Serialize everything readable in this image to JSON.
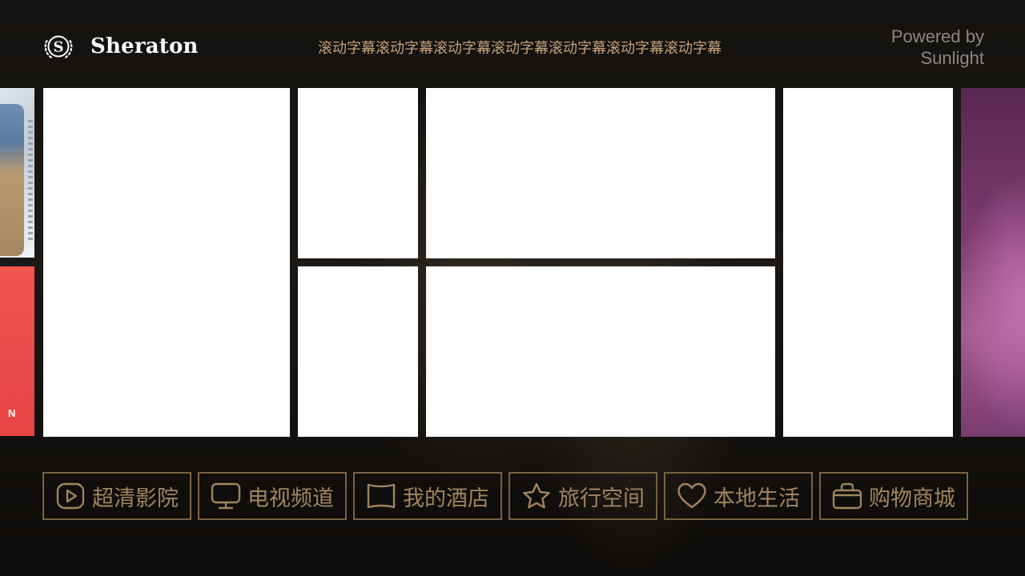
{
  "header": {
    "brand_name": "Sheraton",
    "marquee_text": "滚动字幕滚动字幕滚动字幕滚动字幕滚动字幕滚动字幕滚动字幕",
    "powered_line1": "Powered by",
    "powered_line2": "Sunlight"
  },
  "edge_tiles": {
    "left_bottom_letter": "N"
  },
  "nav": [
    {
      "label": "超清影院",
      "icon": "play-icon"
    },
    {
      "label": "电视频道",
      "icon": "monitor-icon"
    },
    {
      "label": "我的酒店",
      "icon": "flag-icon"
    },
    {
      "label": "旅行空间",
      "icon": "star-icon"
    },
    {
      "label": "本地生活",
      "icon": "heart-icon"
    },
    {
      "label": "购物商城",
      "icon": "shopping-bag-icon"
    }
  ],
  "colors": {
    "accent_gold": "#a0845d",
    "marquee_gold": "#c5a27a",
    "nav_border": "#7a6242",
    "tile_white": "#ffffff"
  }
}
